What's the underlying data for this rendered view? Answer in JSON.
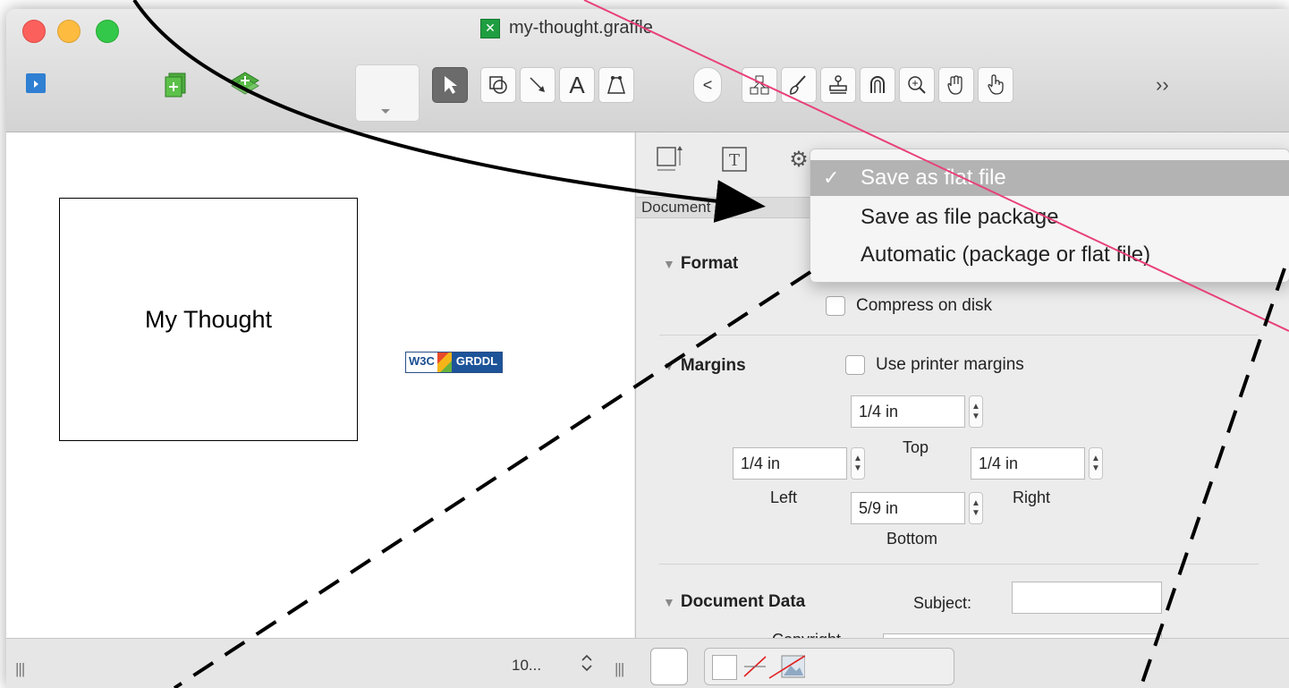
{
  "window": {
    "title": "my-thought.graffle"
  },
  "toolbar": {
    "more_label": "››",
    "tools": [
      {
        "name": "selection-tool",
        "glyph": "↖"
      },
      {
        "name": "shape-tool",
        "glyph": "⧉"
      },
      {
        "name": "line-tool",
        "glyph": "↘"
      },
      {
        "name": "text-tool",
        "glyph": "A"
      },
      {
        "name": "pen-tool",
        "glyph": "⌂"
      },
      {
        "name": "diagram-tool",
        "glyph": "☘"
      },
      {
        "name": "style-brush-tool",
        "glyph": "✒"
      },
      {
        "name": "rubber-stamp-tool",
        "glyph": "⚖"
      },
      {
        "name": "magnet-tool",
        "glyph": "∩"
      },
      {
        "name": "zoom-tool",
        "glyph": "⊕"
      },
      {
        "name": "hand-tool",
        "glyph": "✋"
      },
      {
        "name": "browse-tool",
        "glyph": "☝"
      }
    ]
  },
  "canvas": {
    "shape_text": "My Thought",
    "badge": {
      "w3c": "W3C",
      "label": "GRDDL"
    }
  },
  "inspector": {
    "header": "Document",
    "format": {
      "title": "Format",
      "compress_label": "Compress on disk",
      "compress_checked": false
    },
    "margins": {
      "title": "Margins",
      "printer_label": "Use printer margins",
      "printer_checked": false,
      "top": "1/4 in",
      "top_label": "Top",
      "left": "1/4 in",
      "left_label": "Left",
      "right": "1/4 in",
      "right_label": "Right",
      "bottom": "5/9 in",
      "bottom_label": "Bottom"
    },
    "document_data": {
      "title": "Document Data",
      "subject_label": "Subject:",
      "subject_value": "",
      "copyright_label": "Copyright"
    }
  },
  "menu": {
    "check": "✓",
    "items": [
      {
        "label": "Save as flat file",
        "selected": true
      },
      {
        "label": "Save as file package",
        "selected": false
      },
      {
        "label": "Automatic (package or flat file)",
        "selected": false
      }
    ]
  },
  "statusbar": {
    "zoom": "10...",
    "zoom_stepper": "⌃⌄",
    "grip": "|||"
  },
  "colors": {
    "selected_tool": "#6b6b6b",
    "menu_selected": "#b3b3b3",
    "pink_line": "#e8407a",
    "arrow": "#000000"
  }
}
